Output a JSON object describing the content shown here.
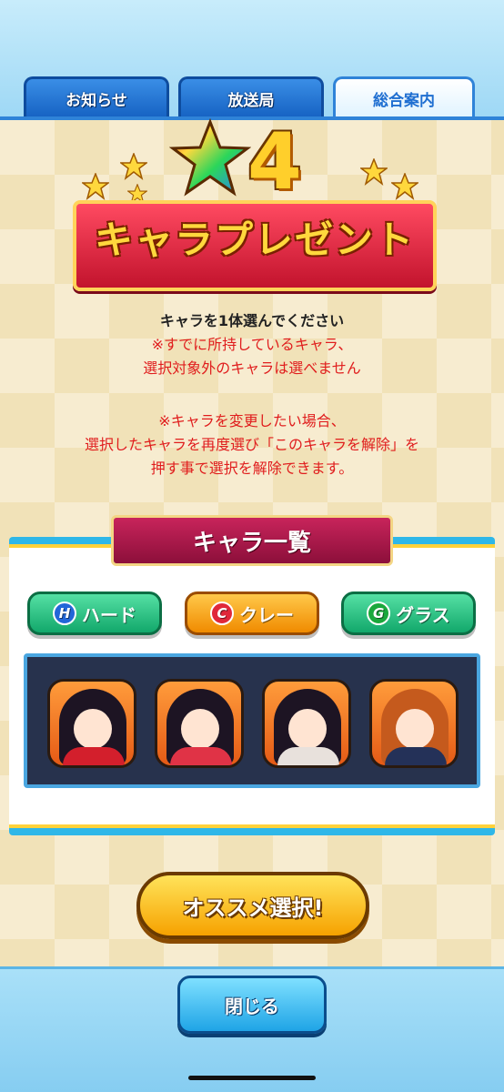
{
  "tabs": [
    {
      "label": "お知らせ",
      "active": false
    },
    {
      "label": "放送局",
      "active": false
    },
    {
      "label": "総合案内",
      "active": true
    }
  ],
  "banner": {
    "rank": "4",
    "title": "キャラプレゼント"
  },
  "instructions": {
    "main": "キャラを1体選んでください",
    "note1_line1": "※すでに所持しているキャラ、",
    "note1_line2": "選択対象外のキャラは選べません",
    "note2_line1": "※キャラを変更したい場合、",
    "note2_line2": "選択したキャラを再度選び「このキャラを解除」を",
    "note2_line3": "押す事で選択を解除できます。"
  },
  "list": {
    "title": "キャラ一覧",
    "filters": [
      {
        "badge": "H",
        "label": "ハード"
      },
      {
        "badge": "C",
        "label": "クレー"
      },
      {
        "badge": "G",
        "label": "グラス"
      }
    ]
  },
  "buttons": {
    "recommend": "オススメ選択!",
    "close": "閉じる"
  }
}
